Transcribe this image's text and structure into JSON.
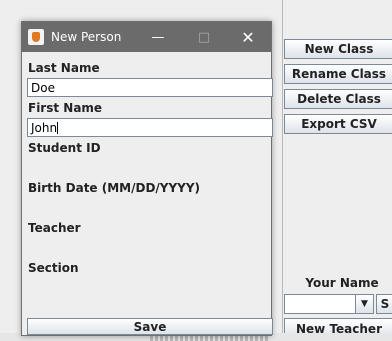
{
  "background": {
    "buttons": {
      "new_class": "New Class",
      "rename_class": "Rename Class",
      "delete_class": "Delete Class",
      "export_csv": "Export CSV",
      "new_teacher": "New Teacher"
    },
    "your_name_label": "Your Name",
    "your_name_combo_value": "",
    "s_button": "S"
  },
  "dialog": {
    "title": "New Person",
    "fields": {
      "last_name": {
        "label": "Last Name",
        "value": "Doe"
      },
      "first_name": {
        "label": "First Name",
        "value": "John"
      },
      "student_id": {
        "label": "Student ID"
      },
      "birth_date": {
        "label": "Birth Date (MM/DD/YYYY)"
      },
      "teacher": {
        "label": "Teacher"
      },
      "section": {
        "label": "Section"
      }
    },
    "save_label": "Save"
  },
  "colors": {
    "titlebar": "#6b6b6b",
    "window_bg": "#eeeeee",
    "button_border": "#7a8a99"
  },
  "icons": [
    "java-app-icon",
    "minimize-icon",
    "maximize-icon",
    "close-icon",
    "dropdown-arrow-icon"
  ]
}
